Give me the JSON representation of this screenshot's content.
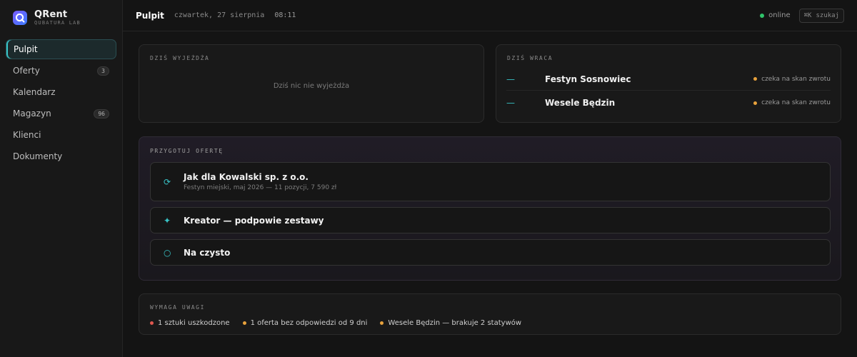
{
  "brand": {
    "name": "QRent",
    "subtitle": "QUBATURA LAB"
  },
  "nav": [
    {
      "label": "Pulpit",
      "active": true,
      "badge": ""
    },
    {
      "label": "Oferty",
      "active": false,
      "badge": "3"
    },
    {
      "label": "Kalendarz",
      "active": false,
      "badge": ""
    },
    {
      "label": "Magazyn",
      "active": false,
      "badge": "96"
    },
    {
      "label": "Klienci",
      "active": false,
      "badge": ""
    },
    {
      "label": "Dokumenty",
      "active": false,
      "badge": ""
    }
  ],
  "topbar": {
    "title": "Pulpit",
    "date": "czwartek, 27 sierpnia",
    "time": "08:11",
    "status": "online",
    "search_shortcut": "⌘K",
    "search_label": "szukaj"
  },
  "departing": {
    "label": "DZIŚ WYJEŻDŻA",
    "empty": "Dziś nic nie wyjeżdża"
  },
  "returning": {
    "label": "DZIŚ WRACA",
    "items": [
      {
        "dash": "—",
        "name": "Festyn Sosnowiec",
        "status": "czeka na skan zwrotu"
      },
      {
        "dash": "—",
        "name": "Wesele Będzin",
        "status": "czeka na skan zwrotu"
      }
    ]
  },
  "prepare": {
    "label": "PRZYGOTUJ OFERTĘ",
    "options": [
      {
        "icon": "refresh-icon",
        "glyph": "⟳",
        "title": "Jak dla Kowalski sp. z o.o.",
        "subtitle": "Festyn miejski, maj 2026 — 11 pozycji, 7 590 zł"
      },
      {
        "icon": "sparkle-icon",
        "glyph": "✦",
        "title": "Kreator — podpowie zestawy",
        "subtitle": ""
      },
      {
        "icon": "circle-icon",
        "glyph": "○",
        "title": "Na czysto",
        "subtitle": ""
      }
    ]
  },
  "attention": {
    "label": "WYMAGA UWAGI",
    "items": [
      {
        "text": "1 sztuki uszkodzone",
        "color": "#e0584f"
      },
      {
        "text": "1 oferta bez odpowiedzi od 9 dni",
        "color": "#e8a23c"
      },
      {
        "text": "Wesele Będzin — brakuje 2 statywów",
        "color": "#e8a23c"
      }
    ]
  },
  "colors": {
    "accent": "#37c6c9",
    "online": "#2fc46a",
    "warning": "#e8a23c",
    "danger": "#e0584f"
  }
}
